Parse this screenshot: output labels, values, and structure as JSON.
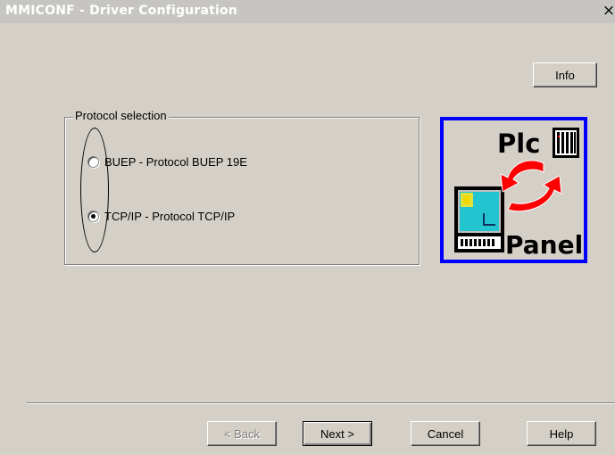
{
  "window": {
    "title": "MMICONF - Driver Configuration",
    "close_symbol": "×"
  },
  "buttons": {
    "info": "Info",
    "back": "< Back",
    "next": "Next >",
    "cancel": "Cancel",
    "help": "Help"
  },
  "protocol_group": {
    "label": "Protocol selection",
    "options": [
      {
        "label": "BUEP - Protocol BUEP 19E",
        "selected": false
      },
      {
        "label": "TCP/IP - Protocol TCP/IP",
        "selected": true
      }
    ]
  },
  "logo": {
    "top_text": "Plc",
    "bottom_text": "Panel",
    "border_color": "#0000ff",
    "arrow_color": "#ff0000"
  }
}
